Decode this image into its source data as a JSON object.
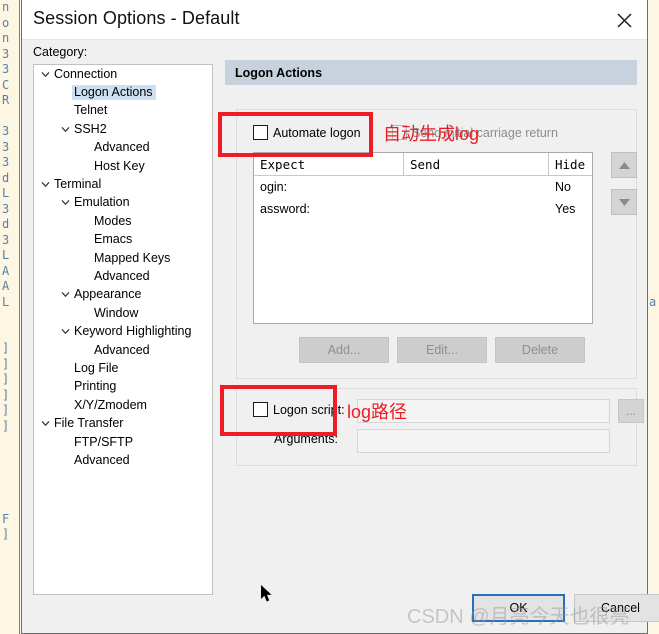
{
  "window": {
    "title": "Session Options - Default",
    "close_icon": "close-icon"
  },
  "category": {
    "label": "Category:",
    "tree": [
      {
        "label": "Connection",
        "indent": 0,
        "expandable": true,
        "selected": false
      },
      {
        "label": "Logon Actions",
        "indent": 1,
        "expandable": false,
        "selected": true
      },
      {
        "label": "Telnet",
        "indent": 1,
        "expandable": false,
        "selected": false
      },
      {
        "label": "SSH2",
        "indent": 1,
        "expandable": true,
        "selected": false
      },
      {
        "label": "Advanced",
        "indent": 2,
        "expandable": false,
        "selected": false
      },
      {
        "label": "Host Key",
        "indent": 2,
        "expandable": false,
        "selected": false
      },
      {
        "label": "Terminal",
        "indent": 0,
        "expandable": true,
        "selected": false
      },
      {
        "label": "Emulation",
        "indent": 1,
        "expandable": true,
        "selected": false
      },
      {
        "label": "Modes",
        "indent": 2,
        "expandable": false,
        "selected": false
      },
      {
        "label": "Emacs",
        "indent": 2,
        "expandable": false,
        "selected": false
      },
      {
        "label": "Mapped Keys",
        "indent": 2,
        "expandable": false,
        "selected": false
      },
      {
        "label": "Advanced",
        "indent": 2,
        "expandable": false,
        "selected": false
      },
      {
        "label": "Appearance",
        "indent": 1,
        "expandable": true,
        "selected": false
      },
      {
        "label": "Window",
        "indent": 2,
        "expandable": false,
        "selected": false
      },
      {
        "label": "Keyword Highlighting",
        "indent": 1,
        "expandable": true,
        "selected": false
      },
      {
        "label": "Advanced",
        "indent": 2,
        "expandable": false,
        "selected": false
      },
      {
        "label": "Log File",
        "indent": 1,
        "expandable": false,
        "selected": false
      },
      {
        "label": "Printing",
        "indent": 1,
        "expandable": false,
        "selected": false
      },
      {
        "label": "X/Y/Zmodem",
        "indent": 1,
        "expandable": false,
        "selected": false
      },
      {
        "label": "File Transfer",
        "indent": 0,
        "expandable": true,
        "selected": false
      },
      {
        "label": "FTP/SFTP",
        "indent": 1,
        "expandable": false,
        "selected": false
      },
      {
        "label": "Advanced",
        "indent": 1,
        "expandable": false,
        "selected": false
      }
    ]
  },
  "main": {
    "header": "Logon Actions",
    "automate_logon": {
      "label": "Automate logon",
      "checked": false
    },
    "initial_cr": {
      "label": "Send initial carriage return",
      "checked": false,
      "disabled": true
    },
    "table": {
      "columns": [
        "Expect",
        "Send",
        "Hide"
      ],
      "rows": [
        {
          "expect": "ogin:",
          "send": "",
          "hide": "No"
        },
        {
          "expect": "assword:",
          "send": "",
          "hide": "Yes"
        }
      ]
    },
    "spinner": {
      "up_icon": "chevron-up-icon",
      "down_icon": "chevron-down-icon"
    },
    "buttons": {
      "add": "Add...",
      "edit": "Edit...",
      "delete": "Delete"
    },
    "script": {
      "checkbox_label": "Logon script:",
      "checked": false,
      "path_value": "",
      "args_label": "Arguments:",
      "args_value": "",
      "browse_label": "..."
    }
  },
  "annotations": {
    "note_automate": "自动生成log",
    "note_script": "log路径",
    "box_color": "#ee1c25"
  },
  "footer": {
    "ok": "OK",
    "cancel": "Cancel"
  },
  "watermark": "CSDN @月亮今天也很亮",
  "background_strip_left": "n\no\nn\n3\n3\nC\nR\n\n3\n3\n3\nd\nL\n3\nd\n3\nL\nA\nA\nL\n\n\n]\n]\n]\n]\n]\n]\n\n\n\n\n\nF\n]",
  "background_strip_right": "a"
}
